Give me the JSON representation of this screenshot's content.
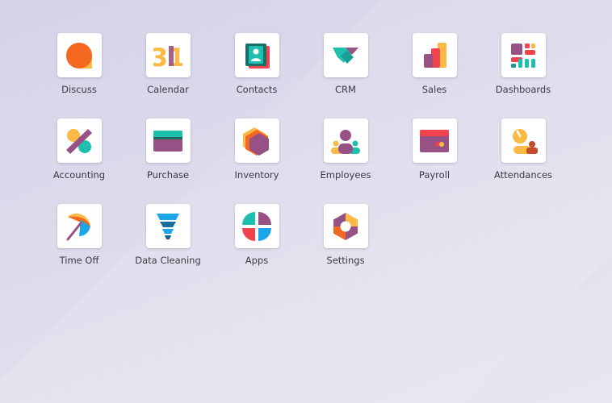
{
  "apps": [
    {
      "label": "Discuss",
      "icon": "discuss-icon"
    },
    {
      "label": "Calendar",
      "icon": "calendar-icon",
      "icon_text": "31"
    },
    {
      "label": "Contacts",
      "icon": "contacts-icon"
    },
    {
      "label": "CRM",
      "icon": "crm-icon"
    },
    {
      "label": "Sales",
      "icon": "sales-icon"
    },
    {
      "label": "Dashboards",
      "icon": "dashboards-icon"
    },
    {
      "label": "Accounting",
      "icon": "accounting-icon"
    },
    {
      "label": "Purchase",
      "icon": "purchase-icon"
    },
    {
      "label": "Inventory",
      "icon": "inventory-icon"
    },
    {
      "label": "Employees",
      "icon": "employees-icon"
    },
    {
      "label": "Payroll",
      "icon": "payroll-icon"
    },
    {
      "label": "Attendances",
      "icon": "attendances-icon"
    },
    {
      "label": "Time Off",
      "icon": "time-off-icon"
    },
    {
      "label": "Data Cleaning",
      "icon": "data-cleaning-icon"
    },
    {
      "label": "Apps",
      "icon": "apps-icon"
    },
    {
      "label": "Settings",
      "icon": "settings-icon"
    }
  ],
  "colors": {
    "orange": "#f5681f",
    "yellow": "#fbb945",
    "teal": "#1fbfb0",
    "purple": "#985184",
    "red": "#f0434e",
    "blue": "#1aa6e8",
    "dark_teal": "#1a6e66"
  }
}
